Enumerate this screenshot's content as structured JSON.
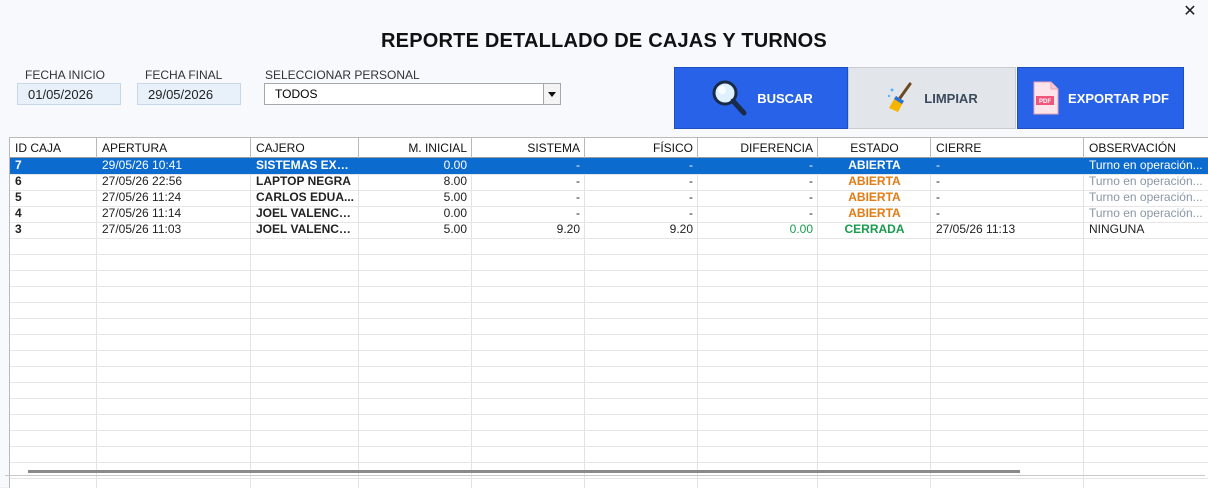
{
  "window": {
    "close": "✕"
  },
  "title": "REPORTE DETALLADO DE CAJAS Y TURNOS",
  "filters": {
    "fecha_inicio_label": "FECHA INICIO",
    "fecha_inicio_value": "01/05/2026",
    "fecha_final_label": "FECHA FINAL",
    "fecha_final_value": "29/05/2026",
    "personal_label": "SELECCIONAR PERSONAL",
    "personal_value": "TODOS"
  },
  "buttons": {
    "buscar": "BUSCAR",
    "limpiar": "LIMPIAR",
    "exportar": "EXPORTAR PDF",
    "pdf_badge": "PDF"
  },
  "colors": {
    "accent_blue": "#2862e8",
    "selected_row": "#0b6bce",
    "estado_abierta": "#e07a12",
    "estado_cerrada": "#1a9c50",
    "diferencia_zero": "#1a9c50",
    "observacion_muted": "#8a97a6"
  },
  "table": {
    "headers": [
      "ID CAJA",
      "APERTURA",
      "CAJERO",
      "M. INICIAL",
      "SISTEMA",
      "FÍSICO",
      "DIFERENCIA",
      "ESTADO",
      "CIERRE",
      "OBSERVACIÓN"
    ],
    "rows": [
      {
        "id": "7",
        "apertura": "29/05/26 10:41",
        "cajero": "SISTEMAS EXCEL",
        "inicial": "0.00",
        "sistema": "-",
        "fisico": "-",
        "diferencia": "-",
        "estado": "ABIERTA",
        "cierre": "-",
        "obs": "Turno en operación...",
        "selected": true
      },
      {
        "id": "6",
        "apertura": "27/05/26 22:56",
        "cajero": "LAPTOP NEGRA",
        "inicial": "8.00",
        "sistema": "-",
        "fisico": "-",
        "diferencia": "-",
        "estado": "ABIERTA",
        "cierre": "-",
        "obs": "Turno en operación...",
        "selected": false
      },
      {
        "id": "5",
        "apertura": "27/05/26 11:24",
        "cajero": "CARLOS EDUA...",
        "inicial": "5.00",
        "sistema": "-",
        "fisico": "-",
        "diferencia": "-",
        "estado": "ABIERTA",
        "cierre": "-",
        "obs": "Turno en operación...",
        "selected": false
      },
      {
        "id": "4",
        "apertura": "27/05/26 11:14",
        "cajero": "JOEL VALENCIA...",
        "inicial": "0.00",
        "sistema": "-",
        "fisico": "-",
        "diferencia": "-",
        "estado": "ABIERTA",
        "cierre": "-",
        "obs": "Turno en operación...",
        "selected": false
      },
      {
        "id": "3",
        "apertura": "27/05/26 11:03",
        "cajero": "JOEL VALENCIA...",
        "inicial": "5.00",
        "sistema": "9.20",
        "fisico": "9.20",
        "diferencia": "0.00",
        "estado": "CERRADA",
        "cierre": "27/05/26 11:13",
        "obs": "NINGUNA",
        "selected": false
      }
    ]
  }
}
